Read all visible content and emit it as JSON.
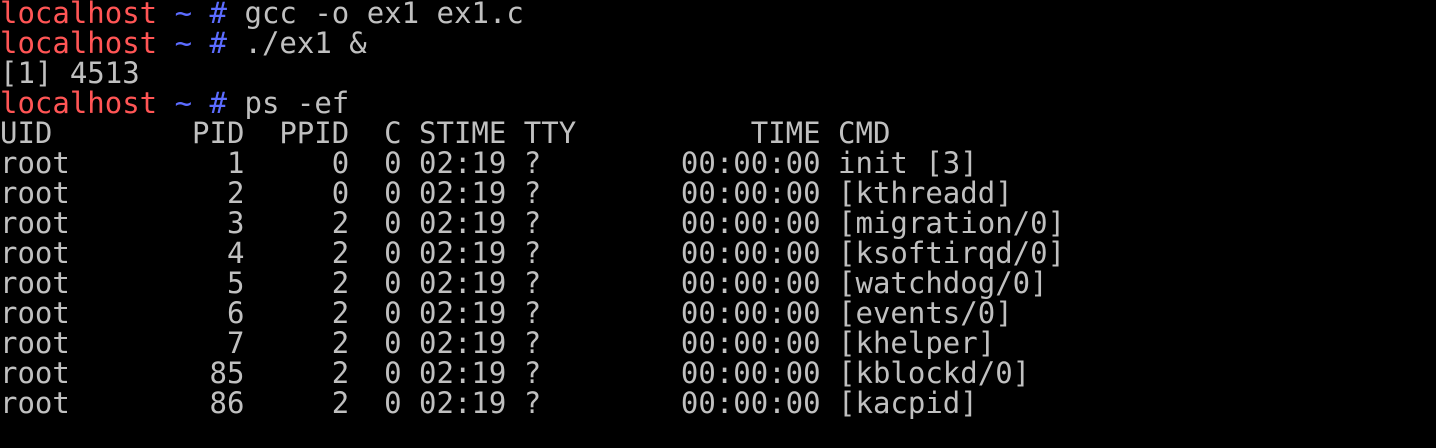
{
  "prompt": {
    "host": "localhost",
    "dir": "~",
    "symbol": "#"
  },
  "commands": [
    "gcc -o ex1 ex1.c",
    "./ex1 &",
    "ps -ef"
  ],
  "job_output": "[1] 4513",
  "ps_header": "UID        PID  PPID  C STIME TTY          TIME CMD",
  "ps_rows": [
    "root         1     0  0 02:19 ?        00:00:00 init [3]",
    "root         2     0  0 02:19 ?        00:00:00 [kthreadd]",
    "root         3     2  0 02:19 ?        00:00:00 [migration/0]",
    "root         4     2  0 02:19 ?        00:00:00 [ksoftirqd/0]",
    "root         5     2  0 02:19 ?        00:00:00 [watchdog/0]",
    "root         6     2  0 02:19 ?        00:00:00 [events/0]",
    "root         7     2  0 02:19 ?        00:00:00 [khelper]",
    "root        85     2  0 02:19 ?        00:00:00 [kblockd/0]",
    "root        86     2  0 02:19 ?        00:00:00 [kacpid]"
  ],
  "colors": {
    "background": "#000000",
    "foreground": "#c0c0c0",
    "host": "#ff5555",
    "prompt_symbol": "#5c6cff"
  }
}
